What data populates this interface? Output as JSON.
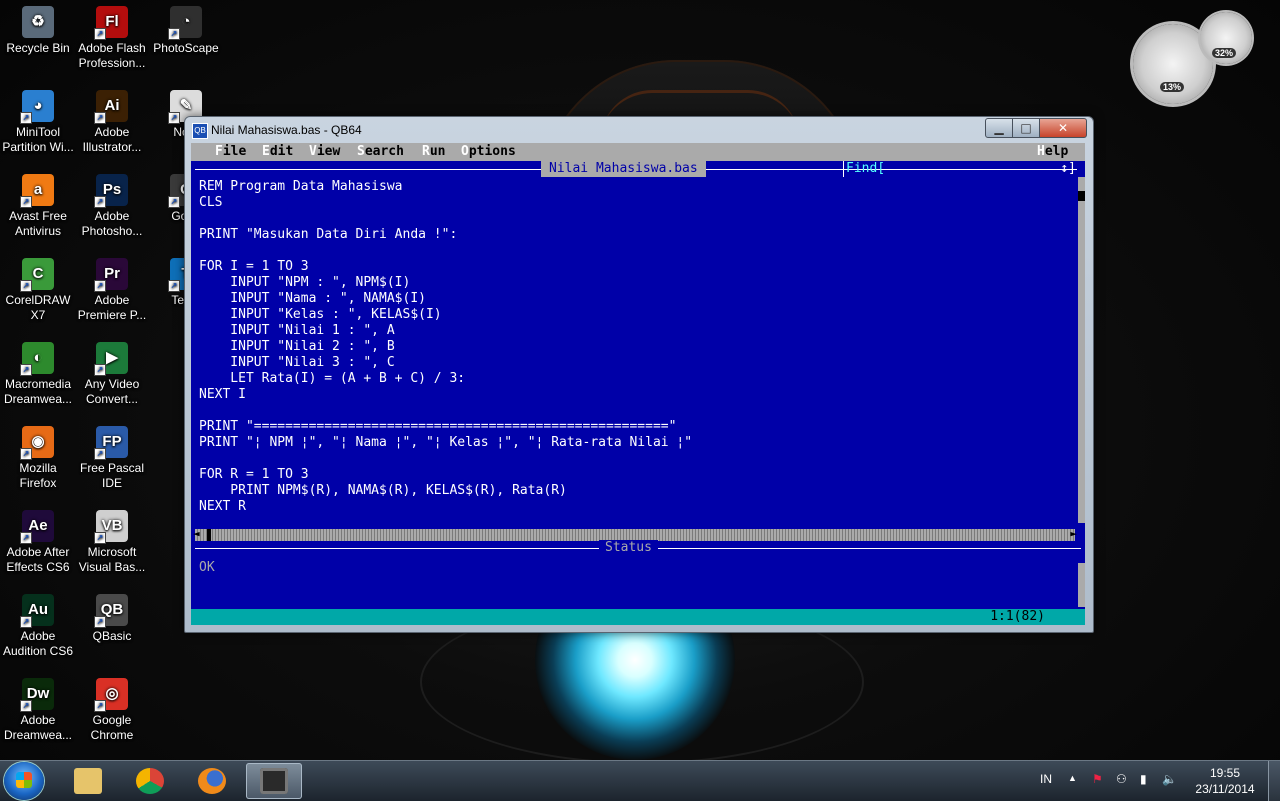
{
  "desktop": {
    "icons": [
      {
        "label": "Recycle Bin",
        "icon": "recycle-bin-icon",
        "color": "#5a6a7a",
        "glyph": "♻"
      },
      {
        "label": "Adobe Flash Profession...",
        "icon": "flash-icon",
        "color": "#b30d0d",
        "glyph": "Fl"
      },
      {
        "label": "PhotoScape",
        "icon": "photoscape-icon",
        "color": "#2f2f2f",
        "glyph": "◔"
      },
      {
        "label": "MiniTool Partition Wi...",
        "icon": "minitool-icon",
        "color": "#2a7fd0",
        "glyph": "◕"
      },
      {
        "label": "Adobe Illustrator...",
        "icon": "illustrator-icon",
        "color": "#3b2004",
        "glyph": "Ai"
      },
      {
        "label": "Note",
        "icon": "notepad-icon",
        "color": "#dcdcdc",
        "glyph": "✎"
      },
      {
        "label": "Avast Free Antivirus",
        "icon": "avast-icon",
        "color": "#f07a13",
        "glyph": "a"
      },
      {
        "label": "Adobe Photosho...",
        "icon": "photoshop-icon",
        "color": "#08234a",
        "glyph": "Ps"
      },
      {
        "label": "Goog",
        "icon": "google-icon",
        "color": "#3a3a3a",
        "glyph": "G"
      },
      {
        "label": "CorelDRAW X7",
        "icon": "coreldraw-icon",
        "color": "#3a9a3a",
        "glyph": "C"
      },
      {
        "label": "Adobe Premiere P...",
        "icon": "premiere-icon",
        "color": "#2a0838",
        "glyph": "Pr"
      },
      {
        "label": "Team",
        "icon": "teamviewer-icon",
        "color": "#0e6fb8",
        "glyph": "T"
      },
      {
        "label": "Macromedia Dreamwea...",
        "icon": "macromedia-icon",
        "color": "#2d8a2d",
        "glyph": "◐"
      },
      {
        "label": "Any Video Convert...",
        "icon": "video-converter-icon",
        "color": "#1c7a3a",
        "glyph": "▶"
      },
      {
        "label": "Mozilla Firefox",
        "icon": "firefox-icon",
        "color": "#e66a16",
        "glyph": "◉"
      },
      {
        "label": "Free Pascal IDE",
        "icon": "free-pascal-icon",
        "color": "#2a5aa8",
        "glyph": "FP"
      },
      {
        "label": "Adobe After Effects CS6",
        "icon": "after-effects-icon",
        "color": "#1f0a3a",
        "glyph": "Ae"
      },
      {
        "label": "Microsoft Visual Bas...",
        "icon": "visual-basic-icon",
        "color": "#cfcfcf",
        "glyph": "VB"
      },
      {
        "label": "Adobe Audition CS6",
        "icon": "audition-icon",
        "color": "#05301c",
        "glyph": "Au"
      },
      {
        "label": "QBasic",
        "icon": "qbasic-icon",
        "color": "#4a4a4a",
        "glyph": "QB"
      },
      {
        "label": "Adobe Dreamwea...",
        "icon": "dreamweaver-icon",
        "color": "#0a2a0a",
        "glyph": "Dw"
      },
      {
        "label": "Google Chrome",
        "icon": "chrome-icon",
        "color": "#d93025",
        "glyph": "◎"
      }
    ]
  },
  "gadget": {
    "cpu_percent": "13%",
    "memory_percent": "32%"
  },
  "window": {
    "title": "Nilai Mahasiswa.bas - QB64",
    "app_icon_text": "QB",
    "minimize_label": "▁",
    "maximize_label": "□",
    "close_label": "✕"
  },
  "menu": {
    "items": [
      {
        "hot": "F",
        "rest": "ile"
      },
      {
        "hot": "E",
        "rest": "dit"
      },
      {
        "hot": "V",
        "rest": "iew"
      },
      {
        "hot": "S",
        "rest": "earch"
      },
      {
        "hot": "R",
        "rest": "un"
      },
      {
        "hot": "O",
        "rest": "ptions"
      }
    ],
    "help": {
      "hot": "H",
      "rest": "elp"
    }
  },
  "editor": {
    "tab_title": "Nilai Mahasiswa.bas",
    "find_label": "Find[",
    "find_arrows": "↕]",
    "code_lines": [
      "REM Program Data Mahasiswa",
      "CLS",
      "",
      "PRINT \"Masukan Data Diri Anda !\":",
      "",
      "FOR I = 1 TO 3",
      "    INPUT \"NPM : \", NPM$(I)",
      "    INPUT \"Nama : \", NAMA$(I)",
      "    INPUT \"Kelas : \", KELAS$(I)",
      "    INPUT \"Nilai 1 : \", A",
      "    INPUT \"Nilai 2 : \", B",
      "    INPUT \"Nilai 3 : \", C",
      "    LET Rata(I) = (A + B + C) / 3:",
      "NEXT I",
      "",
      "PRINT \"=====================================================\"",
      "PRINT \"¦ NPM ¦\", \"¦ Nama ¦\", \"¦ Kelas ¦\", \"¦ Rata-rata Nilai ¦\"",
      "",
      "FOR R = 1 TO 3",
      "    PRINT NPM$(R), NAMA$(R), KELAS$(R), Rata(R)",
      "NEXT R"
    ]
  },
  "status": {
    "title": "Status",
    "text": "OK"
  },
  "cursor_position": "1:1(82)",
  "taskbar": {
    "language": "IN",
    "time": "19:55",
    "date": "23/11/2014",
    "tray_up": "▲",
    "tray_flag": "⚑",
    "tray_signal": "▮",
    "tray_volume": "🔈"
  },
  "colors": {
    "qb_blue": "#0000a8",
    "qb_gray": "#aaaaaa",
    "qb_cyan": "#00a8a8"
  }
}
